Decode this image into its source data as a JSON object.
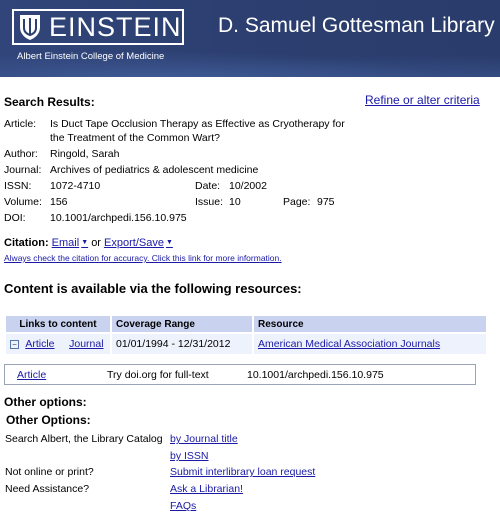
{
  "header": {
    "logo_text": "EINSTEIN",
    "college": "Albert Einstein College of Medicine",
    "library": "D. Samuel Gottesman Library"
  },
  "search": {
    "title": "Search Results:",
    "refine_link": "Refine or alter criteria"
  },
  "citation": {
    "article_label": "Article:",
    "article_value": "Is Duct Tape Occlusion Therapy as Effective as Cryotherapy for the Treatment of the Common Wart?",
    "author_label": "Author:",
    "author_value": "Ringold, Sarah",
    "journal_label": "Journal:",
    "journal_value": "Archives of pediatrics & adolescent medicine",
    "issn_label": "ISSN:",
    "issn_value": "1072-4710",
    "date_label": "Date:",
    "date_value": "10/2002",
    "volume_label": "Volume:",
    "volume_value": "156",
    "issue_label": "Issue:",
    "issue_value": "10",
    "page_label": "Page:",
    "page_value": "975",
    "doi_label": "DOI:",
    "doi_value": "10.1001/archpedi.156.10.975"
  },
  "citation_tools": {
    "label": "Citation:",
    "email": "Email",
    "or": "or",
    "export": "Export/Save",
    "accuracy_note": "Always check the citation for accuracy. Click this link for more information."
  },
  "resources": {
    "title": "Content is available via the following resources:",
    "headers": [
      "Links to content",
      "Coverage Range",
      "Resource"
    ],
    "row": {
      "expander": "−",
      "article": "Article",
      "journal": "Journal",
      "coverage": "01/01/1994 - 12/31/2012",
      "resource": "American Medical Association Journals"
    }
  },
  "doi_row": {
    "article": "Article",
    "text": "Try doi.org for full-text",
    "doi": "10.1001/archpedi.156.10.975"
  },
  "other": {
    "title": "Other options:",
    "subtitle": "Other Options:",
    "catalog_label": "Search Albert, the Library Catalog",
    "by_title": "by Journal title",
    "by_issn": "by ISSN",
    "not_online_label": "Not online or print?",
    "ill": "Submit interlibrary loan request",
    "assist_label": "Need Assistance?",
    "ask": "Ask a Librarian!",
    "faqs": "FAQs"
  }
}
